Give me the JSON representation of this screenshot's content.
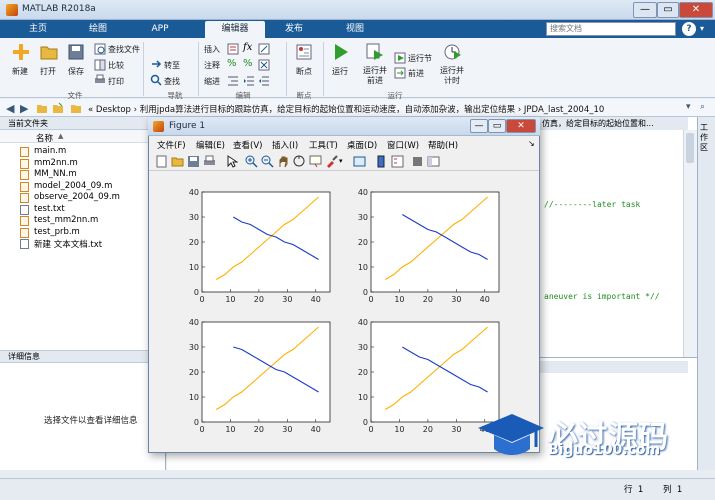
{
  "window": {
    "title": "MATLAB R2018a",
    "minimize": "—",
    "maximize": "▭",
    "close": "✕"
  },
  "tabs": [
    {
      "label": "主页"
    },
    {
      "label": "绘图"
    },
    {
      "label": "APP"
    },
    {
      "label": "编辑器"
    },
    {
      "label": "发布"
    },
    {
      "label": "视图"
    }
  ],
  "search": {
    "placeholder": "搜索文档"
  },
  "ribbon": {
    "file": {
      "new": "新建",
      "open": "打开",
      "save": "保存",
      "find_files": "查找文件",
      "compare": "比较",
      "print": "打印",
      "group": "文件"
    },
    "navigate": {
      "insert_go": "转至",
      "find": "查找",
      "group": "导航"
    },
    "edit": {
      "insert": "插入",
      "comment": "注释",
      "indent": "缩进",
      "fx": "fx",
      "group": "编辑"
    },
    "breakpoints": {
      "label": "断点",
      "group": "断点"
    },
    "run": {
      "run": "运行",
      "run_advance": "运行并\n前进",
      "run_section": "运行节",
      "advance": "前进",
      "run_time": "运行并\n计时",
      "group": "运行"
    }
  },
  "address": {
    "path": "« Desktop › 利用jpda算法进行目标的跟踪仿真，给定目标的起始位置和运动速度，自动添加杂波，输出定位结果 › JPDA_last_2004_10"
  },
  "current_folder": {
    "header": "当前文件夹",
    "column_name": "名称",
    "files": [
      {
        "name": "main.m",
        "type": "m"
      },
      {
        "name": "mm2nn.m",
        "type": "m"
      },
      {
        "name": "MM_NN.m",
        "type": "m"
      },
      {
        "name": "model_2004_09.m",
        "type": "m"
      },
      {
        "name": "observe_2004_09.m",
        "type": "m"
      },
      {
        "name": "test.txt",
        "type": "txt"
      },
      {
        "name": "test_mm2nn.m",
        "type": "m"
      },
      {
        "name": "test_prb.m",
        "type": "m"
      },
      {
        "name": "新建 文本文档.txt",
        "type": "txt"
      }
    ]
  },
  "details": {
    "header": "详细信息",
    "empty_text": "选择文件以查看详细信息"
  },
  "editor": {
    "tab_title": "仿真，给定目标的起始位置和...",
    "code_comment_1": "//--------later task",
    "code_comment_2": "aneuver is important *//"
  },
  "workspace": {
    "label": "工作区"
  },
  "status": {
    "line_label": "行",
    "line_value": "1",
    "col_label": "列",
    "col_value": "1"
  },
  "figure": {
    "title": "Figure 1",
    "menus": [
      "文件(F)",
      "编辑(E)",
      "查看(V)",
      "插入(I)",
      "工具(T)",
      "桌面(D)",
      "窗口(W)",
      "帮助(H)"
    ],
    "colors": {
      "line_true": "#ffb000",
      "line_est": "#1a3cc8"
    }
  },
  "chart_data": [
    {
      "type": "line",
      "xlim": [
        0,
        45
      ],
      "ylim": [
        0,
        40
      ],
      "xticks": [
        "0",
        "10",
        "20",
        "30",
        "40"
      ],
      "yticks": [
        "0",
        "10",
        "20",
        "30",
        "40"
      ],
      "series": [
        {
          "color": "#ffb000",
          "x": [
            5,
            8,
            11,
            14,
            17,
            20,
            23,
            26,
            29,
            32,
            35,
            38,
            41
          ],
          "y": [
            5,
            7,
            10,
            12,
            15,
            18,
            21,
            24,
            27,
            29,
            32,
            35,
            38
          ]
        },
        {
          "color": "#1a3cc8",
          "x": [
            11,
            14,
            17,
            20,
            23,
            26,
            29,
            32,
            35,
            38,
            41
          ],
          "y": [
            30,
            28,
            27,
            25,
            23,
            22,
            20,
            19,
            17,
            15,
            13
          ]
        }
      ]
    },
    {
      "type": "line",
      "xlim": [
        0,
        45
      ],
      "ylim": [
        0,
        40
      ],
      "xticks": [
        "0",
        "10",
        "20",
        "30",
        "40"
      ],
      "yticks": [
        "0",
        "10",
        "20",
        "30",
        "40"
      ],
      "series": [
        {
          "color": "#ffb000",
          "x": [
            5,
            8,
            11,
            14,
            17,
            20,
            23,
            26,
            29,
            32,
            35,
            38,
            41
          ],
          "y": [
            5,
            7,
            10,
            12,
            15,
            18,
            21,
            24,
            27,
            29,
            32,
            35,
            38
          ]
        },
        {
          "color": "#1a3cc8",
          "x": [
            11,
            14,
            17,
            20,
            23,
            26,
            29,
            32,
            35,
            38,
            41
          ],
          "y": [
            31,
            29,
            27,
            25,
            24,
            22,
            20,
            18,
            16,
            15,
            13
          ]
        }
      ]
    },
    {
      "type": "line",
      "xlim": [
        0,
        45
      ],
      "ylim": [
        0,
        40
      ],
      "xticks": [
        "0",
        "10",
        "20",
        "30",
        "40"
      ],
      "yticks": [
        "0",
        "10",
        "20",
        "30",
        "40"
      ],
      "series": [
        {
          "color": "#ffb000",
          "x": [
            5,
            8,
            11,
            14,
            17,
            20,
            23,
            26,
            29,
            32,
            35,
            38,
            41
          ],
          "y": [
            5,
            7,
            10,
            12,
            15,
            18,
            21,
            24,
            27,
            29,
            32,
            35,
            38
          ]
        },
        {
          "color": "#1a3cc8",
          "x": [
            11,
            14,
            17,
            20,
            23,
            26,
            29,
            32,
            35,
            38,
            41
          ],
          "y": [
            30,
            29,
            27,
            25,
            23,
            21,
            20,
            18,
            16,
            14,
            12
          ]
        }
      ]
    },
    {
      "type": "line",
      "xlim": [
        0,
        45
      ],
      "ylim": [
        0,
        40
      ],
      "xticks": [
        "0",
        "10",
        "20",
        "30",
        "40"
      ],
      "yticks": [
        "0",
        "10",
        "20",
        "30",
        "40"
      ],
      "series": [
        {
          "color": "#ffb000",
          "x": [
            5,
            8,
            11,
            14,
            17,
            20,
            23,
            26,
            29,
            32,
            35,
            38,
            41
          ],
          "y": [
            5,
            7,
            10,
            12,
            15,
            18,
            21,
            24,
            27,
            29,
            32,
            35,
            38
          ]
        },
        {
          "color": "#1a3cc8",
          "x": [
            11,
            14,
            17,
            20,
            23,
            26,
            29,
            32,
            35,
            38,
            41
          ],
          "y": [
            30,
            28,
            26,
            25,
            23,
            21,
            19,
            17,
            15,
            14,
            12
          ]
        }
      ]
    }
  ],
  "watermark": {
    "text": "必过源码",
    "url": "Biguo100.com"
  }
}
